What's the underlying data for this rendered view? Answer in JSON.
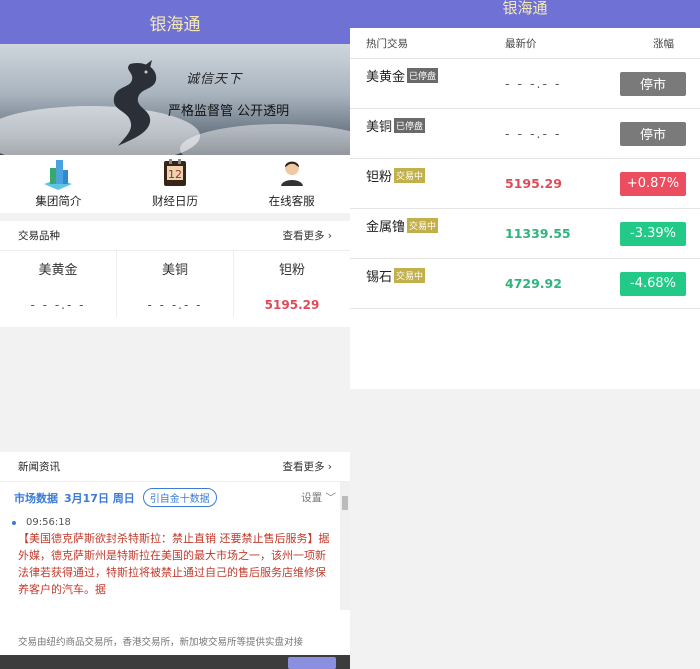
{
  "app": {
    "title": "银海通"
  },
  "banner": {
    "calligraphy": "诚信天下",
    "slogan": "严格监督管 公开透明"
  },
  "quicknav": [
    {
      "label": "集团简介",
      "icon": "buildings-icon"
    },
    {
      "label": "财经日历",
      "icon": "calendar-icon",
      "icon_text": "12"
    },
    {
      "label": "在线客服",
      "icon": "customer-service-icon"
    }
  ],
  "products": {
    "title": "交易品种",
    "more": "查看更多 ›",
    "items": [
      {
        "name": "美黄金",
        "value": "- - -.- -"
      },
      {
        "name": "美铜",
        "value": "- - -.- -"
      },
      {
        "name": "钽粉",
        "value": "5195.29"
      }
    ]
  },
  "news": {
    "title": "新闻资讯",
    "more": "查看更多 ›",
    "market_label": "市场数据",
    "market_date": "3月17日 周日",
    "pill": "引自金十数据",
    "settings": "设置 ﹀",
    "time": "09:56:18",
    "text": "【美国德克萨斯欲封杀特斯拉：禁止直销 还要禁止售后服务】据外媒，德克萨斯州是特斯拉在美国的最大市场之一，该州一项新法律若获得通过，特斯拉将被禁止通过自己的售后服务店维修保养客户的汽车。据",
    "footer": "交易由纽约商品交易所，香港交易所，新加坡交易所等提供实盘对接"
  },
  "market": {
    "title": "银海通",
    "columns": {
      "name": "热门交易",
      "price": "最新价",
      "change": "涨幅"
    },
    "rows": [
      {
        "name": "美黄金",
        "badge": "已停盘",
        "status": "stop",
        "price": "- - -.- -",
        "change": "停市"
      },
      {
        "name": "美铜",
        "badge": "已停盘",
        "status": "stop",
        "price": "- - -.- -",
        "change": "停市"
      },
      {
        "name": "钽粉",
        "badge": "交易中",
        "status": "up",
        "price": "5195.29",
        "change": "+0.87%"
      },
      {
        "name": "金属镥",
        "badge": "交易中",
        "status": "down",
        "price": "11339.55",
        "change": "-3.39%"
      },
      {
        "name": "锡石",
        "badge": "交易中",
        "status": "down",
        "price": "4729.92",
        "change": "-4.68%"
      }
    ]
  },
  "colors": {
    "header_bg": "#6f72d4",
    "header_text": "#f4e9b8",
    "up": "#ec4d5f",
    "down": "#22c987",
    "stop": "#7a7a7a"
  }
}
